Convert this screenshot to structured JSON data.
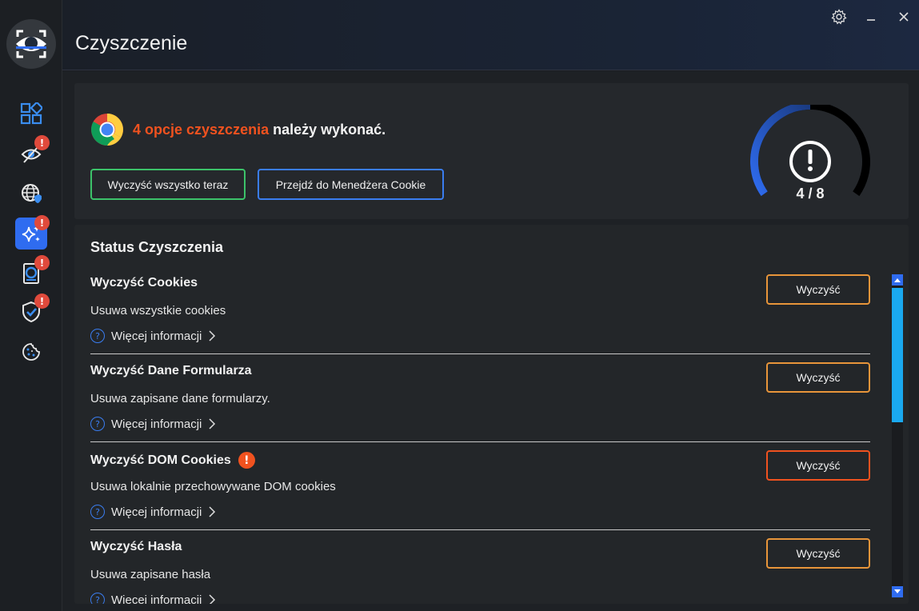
{
  "header": {
    "title": "Czyszczenie"
  },
  "sidebar": {
    "items": [
      {
        "icon": "dashboard-icon",
        "badge": ""
      },
      {
        "icon": "eye-privacy-icon",
        "badge": "!"
      },
      {
        "icon": "globe-shield-icon",
        "badge": ""
      },
      {
        "icon": "sparkle-clean-icon",
        "badge": "!",
        "active": true
      },
      {
        "icon": "id-card-icon",
        "badge": "!"
      },
      {
        "icon": "shield-check-icon",
        "badge": "!"
      },
      {
        "icon": "cookie-icon",
        "badge": ""
      }
    ]
  },
  "summary": {
    "highlight": "4 opcje czyszczenia",
    "rest": " należy wykonać.",
    "clean_all_label": "Wyczyść wszystko teraz",
    "cookie_manager_label": "Przejdź do Menedżera Cookie"
  },
  "gauge": {
    "count": "4 / 8",
    "progress": 0.5,
    "color": "#2f6cf0"
  },
  "status": {
    "title": "Status Czyszczenia",
    "rows": [
      {
        "title": "Wyczyść Cookies",
        "desc": "Usuwa wszystkie cookies",
        "more": "Więcej informacji",
        "button": "Wyczyść",
        "warning": false
      },
      {
        "title": "Wyczyść Dane Formularza",
        "desc": "Usuwa zapisane dane formularzy.",
        "more": "Więcej informacji",
        "button": "Wyczyść",
        "warning": false
      },
      {
        "title": "Wyczyść DOM Cookies",
        "desc": "Usuwa lokalnie przechowywane DOM cookies",
        "more": "Więcej informacji",
        "button": "Wyczyść",
        "warning": true
      },
      {
        "title": "Wyczyść Hasła",
        "desc": "Usuwa zapisane hasła",
        "more": "Więcej informacji",
        "button": "Wyczyść",
        "warning": false
      }
    ]
  }
}
